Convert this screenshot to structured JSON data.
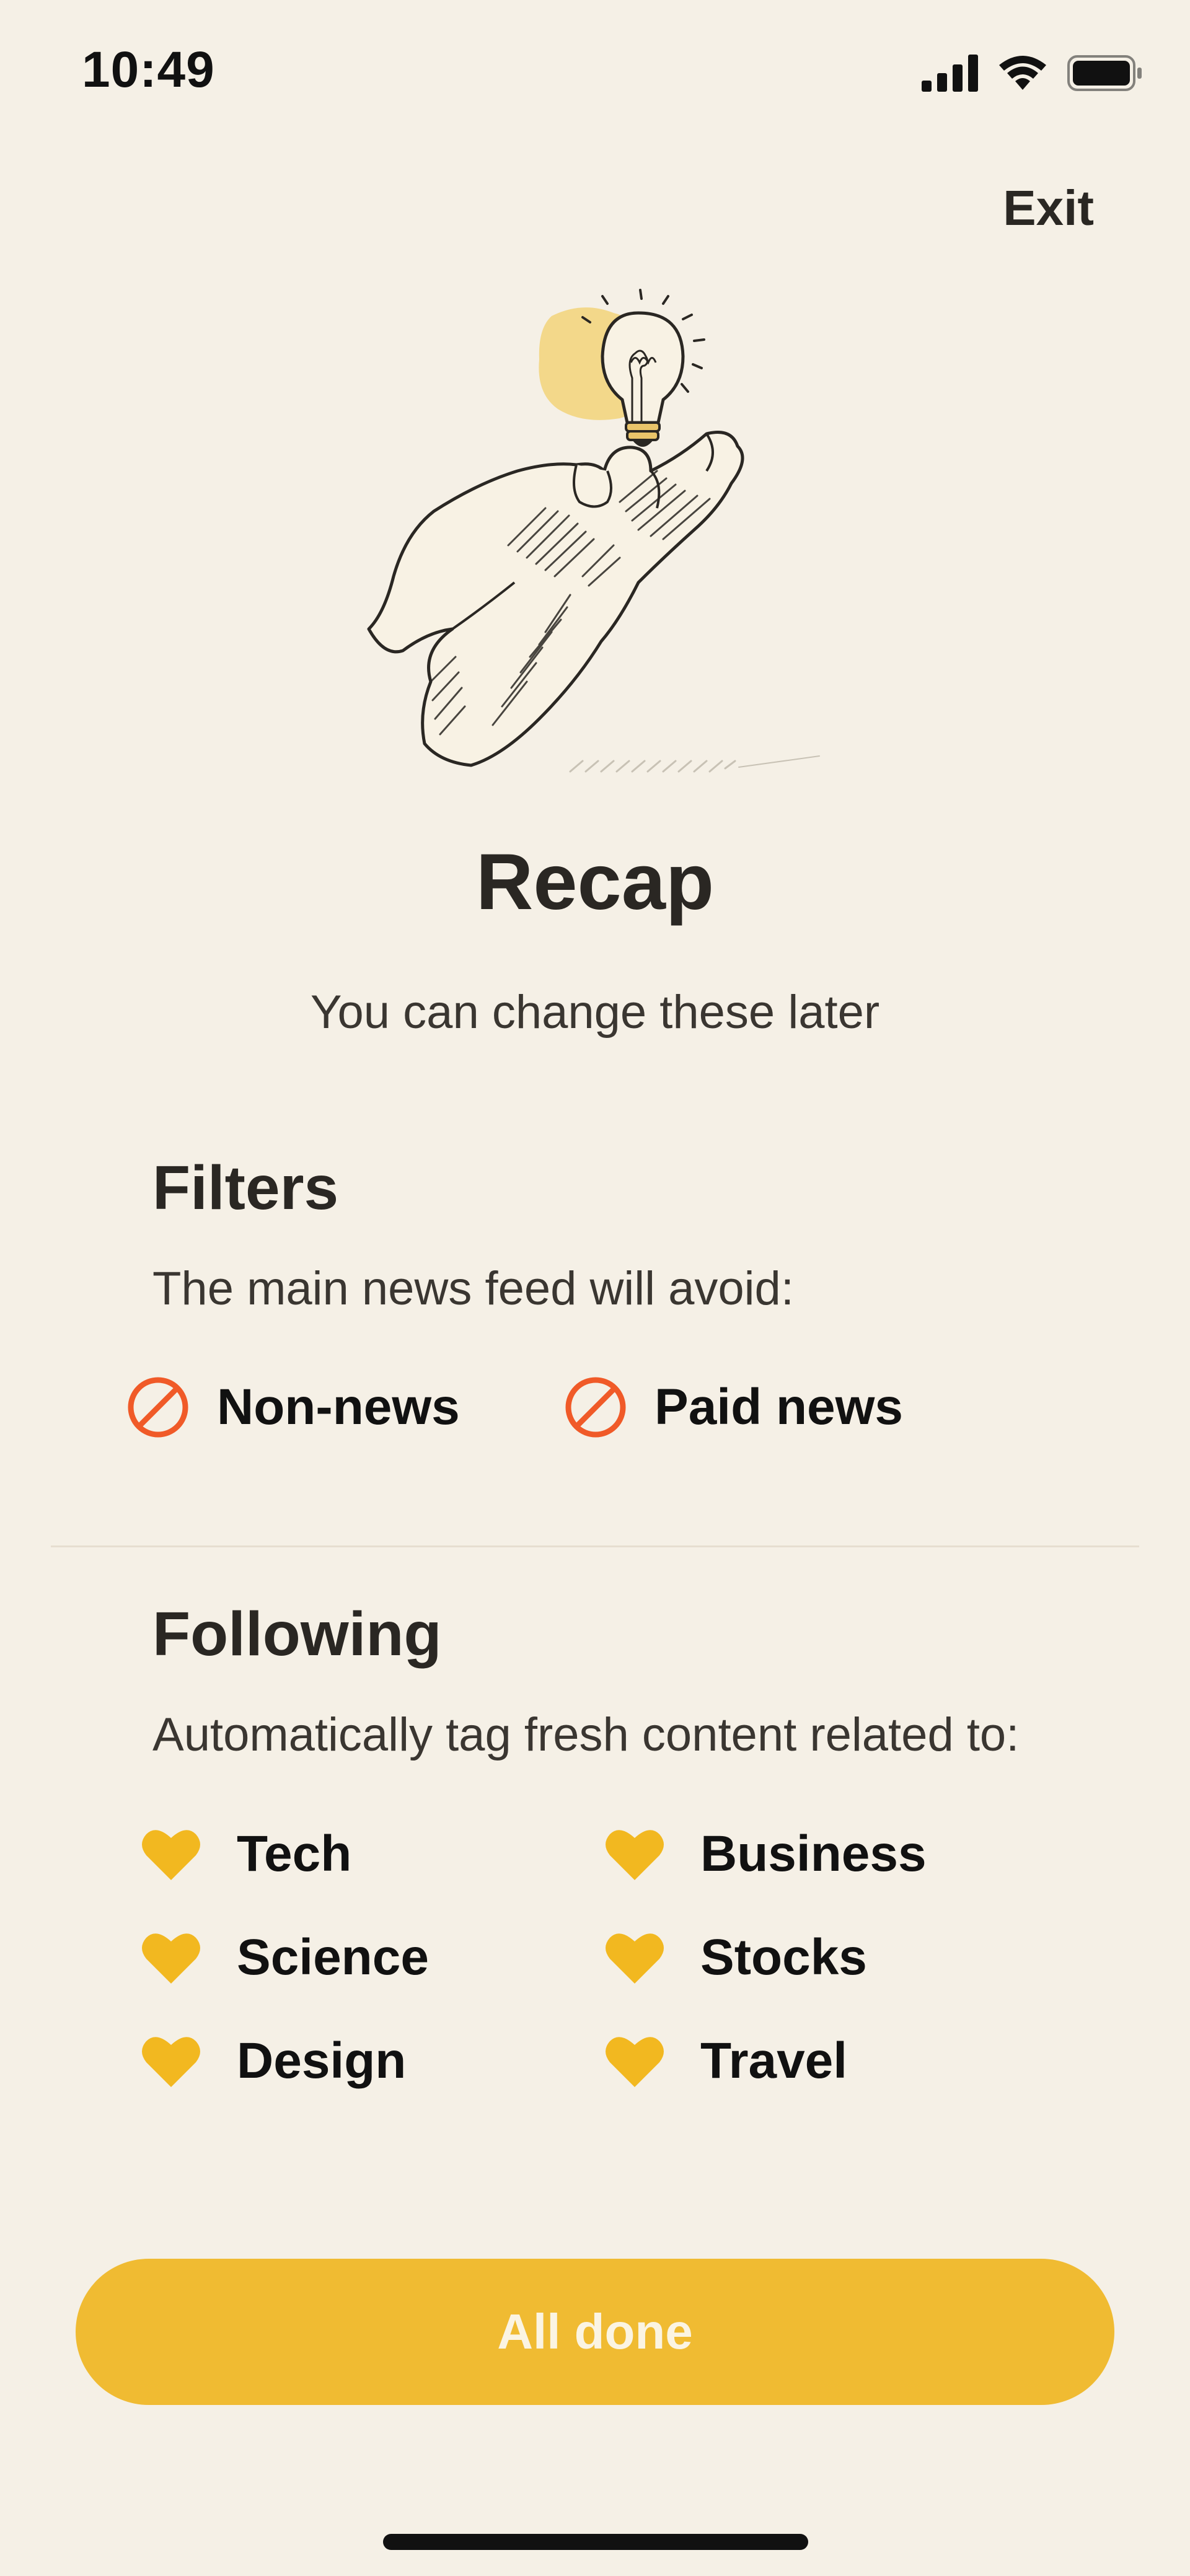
{
  "status_bar": {
    "time": "10:49"
  },
  "header": {
    "exit_label": "Exit"
  },
  "main": {
    "title": "Recap",
    "subtitle": "You can change these later"
  },
  "filters": {
    "heading": "Filters",
    "description": "The main news feed will avoid:",
    "items": [
      {
        "label": "Non-news",
        "icon": "block-icon"
      },
      {
        "label": "Paid news",
        "icon": "block-icon"
      }
    ]
  },
  "following": {
    "heading": "Following",
    "description": "Automatically tag fresh content related to:",
    "topics": [
      {
        "label": "Tech",
        "icon": "heart-icon"
      },
      {
        "label": "Business",
        "icon": "heart-icon"
      },
      {
        "label": "Science",
        "icon": "heart-icon"
      },
      {
        "label": "Stocks",
        "icon": "heart-icon"
      },
      {
        "label": "Design",
        "icon": "heart-icon"
      },
      {
        "label": "Travel",
        "icon": "heart-icon"
      }
    ]
  },
  "footer": {
    "done_label": "All done"
  },
  "colors": {
    "background": "#f5f0e6",
    "accent": "#f0bb32",
    "heart": "#f2b820",
    "block": "#f05a28",
    "text": "#2a2723"
  }
}
